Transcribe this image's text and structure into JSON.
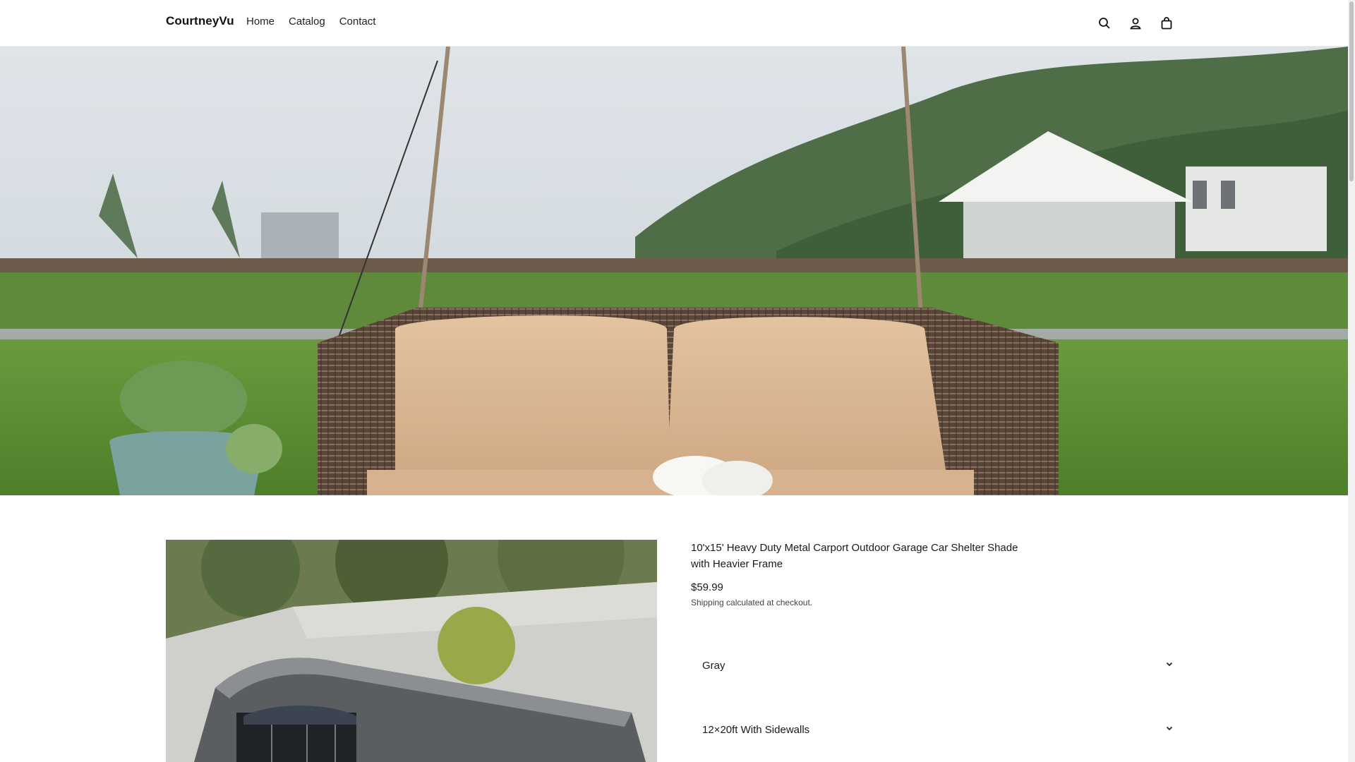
{
  "header": {
    "brand": "CourtneyVu",
    "nav": [
      {
        "label": "Home"
      },
      {
        "label": "Catalog"
      },
      {
        "label": "Contact"
      }
    ],
    "icons": [
      "search-icon",
      "account-icon",
      "cart-icon"
    ]
  },
  "hero": {
    "image": "outdoor-wicker-swing-sofa-scene"
  },
  "product": {
    "image": "metal-carport-shelter-photo",
    "title": "10'x15' Heavy Duty Metal Carport Outdoor Garage Car Shelter Shade with Heavier Frame",
    "price": "$59.99",
    "shipping_note": "Shipping calculated at checkout.",
    "options": {
      "color": {
        "selected": "Gray"
      },
      "size": {
        "selected": "12×20ft With Sidewalls"
      }
    }
  },
  "colors": {
    "text": "#1a1a1a",
    "background": "#ffffff",
    "cushion": "#dcb892",
    "grass": "#5f8f3a"
  }
}
